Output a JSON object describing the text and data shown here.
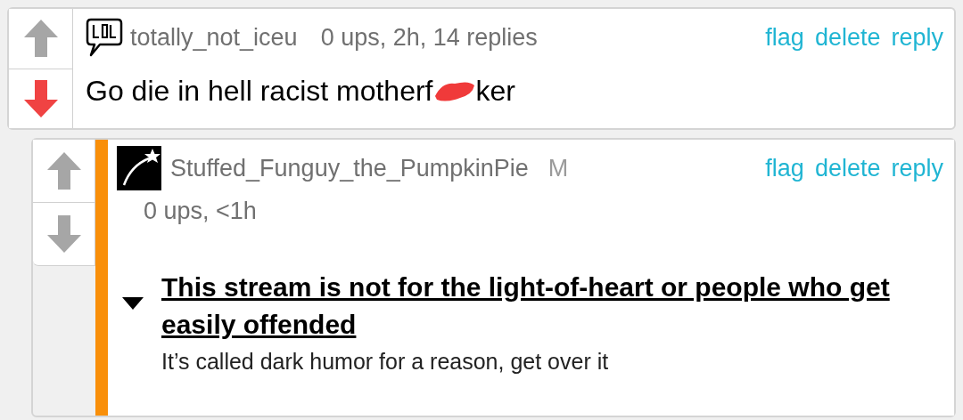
{
  "comments": [
    {
      "username": "totally_not_iceu",
      "meta": "0 ups, 2h, 14 replies",
      "avatar": {
        "kind": "lol"
      },
      "upvoted": false,
      "downvoted": true,
      "actions": [
        "flag",
        "delete",
        "reply"
      ],
      "text_before": "Go die in hell racist motherf",
      "text_after": "ker"
    },
    {
      "username": "Stuffed_Funguy_the_PumpkinPie",
      "badge": "M",
      "meta": "0 ups, <1h",
      "avatar": {
        "kind": "star"
      },
      "upvoted": false,
      "downvoted": false,
      "actions": [
        "flag",
        "delete",
        "reply"
      ],
      "embed": {
        "heading": "This stream is not for the light-of-heart or people who get easily offended",
        "subtitle": "It’s called dark humor for a reason, get over it"
      }
    }
  ]
}
